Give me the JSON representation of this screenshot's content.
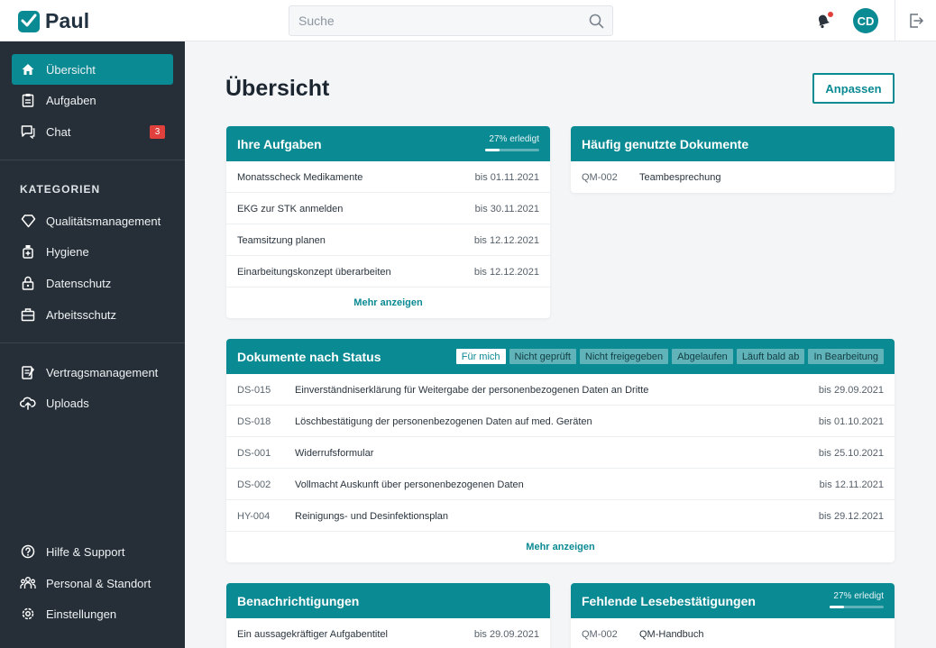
{
  "app": {
    "name": "Paul"
  },
  "header": {
    "search_placeholder": "Suche",
    "avatar_initials": "CD"
  },
  "sidebar": {
    "main": [
      {
        "label": "Übersicht",
        "icon": "home-icon",
        "active": true
      },
      {
        "label": "Aufgaben",
        "icon": "clipboard-icon"
      },
      {
        "label": "Chat",
        "icon": "chat-icon",
        "badge": "3"
      }
    ],
    "categories_heading": "KATEGORIEN",
    "categories": [
      {
        "label": "Qualitätsmanagement",
        "icon": "diamond-icon"
      },
      {
        "label": "Hygiene",
        "icon": "hygiene-bottle-icon"
      },
      {
        "label": "Datenschutz",
        "icon": "lock-icon"
      },
      {
        "label": "Arbeitsschutz",
        "icon": "briefcase-icon"
      }
    ],
    "other": [
      {
        "label": "Vertragsmanagement",
        "icon": "contract-icon"
      },
      {
        "label": "Uploads",
        "icon": "cloud-upload-icon"
      }
    ],
    "footer": [
      {
        "label": "Hilfe & Support",
        "icon": "help-icon"
      },
      {
        "label": "Personal & Standort",
        "icon": "people-icon"
      },
      {
        "label": "Einstellungen",
        "icon": "gear-icon"
      }
    ]
  },
  "main": {
    "title": "Übersicht",
    "customize_label": "Anpassen",
    "tasks": {
      "title": "Ihre Aufgaben",
      "progress_label": "27% erledigt",
      "progress": 0.27,
      "rows": [
        {
          "title": "Monatsscheck Medikamente",
          "due": "bis 01.11.2021"
        },
        {
          "title": "EKG zur STK anmelden",
          "due": "bis 30.11.2021"
        },
        {
          "title": "Teamsitzung planen",
          "due": "bis 12.12.2021"
        },
        {
          "title": "Einarbeitungskonzept überarbeiten",
          "due": "bis 12.12.2021"
        }
      ],
      "more_label": "Mehr anzeigen"
    },
    "frequent_docs": {
      "title": "Häufig genutzte Dokumente",
      "rows": [
        {
          "code": "QM-002",
          "title": "Teambesprechung"
        }
      ]
    },
    "status_docs": {
      "title": "Dokumente nach Status",
      "filters": [
        {
          "label": "Für mich",
          "active": true
        },
        {
          "label": "Nicht geprüft"
        },
        {
          "label": "Nicht freigegeben"
        },
        {
          "label": "Abgelaufen"
        },
        {
          "label": "Läuft bald ab"
        },
        {
          "label": "In Bearbeitung"
        }
      ],
      "rows": [
        {
          "code": "DS-015",
          "title": "Einverständniserklärung für Weitergabe der personenbezogenen Daten an Dritte",
          "due": "bis 29.09.2021"
        },
        {
          "code": "DS-018",
          "title": "Löschbestätigung der personenbezogenen Daten auf med. Geräten",
          "due": "bis 01.10.2021"
        },
        {
          "code": "DS-001",
          "title": "Widerrufsformular",
          "due": "bis 25.10.2021"
        },
        {
          "code": "DS-002",
          "title": "Vollmacht Auskunft über personenbezogenen Daten",
          "due": "bis 12.11.2021"
        },
        {
          "code": "HY-004",
          "title": "Reinigungs- und Desinfektionsplan",
          "due": "bis 29.12.2021"
        }
      ],
      "more_label": "Mehr anzeigen"
    },
    "notifications": {
      "title": "Benachrichtigungen",
      "rows": [
        {
          "title": "Ein aussagekräftiger Aufgabentitel",
          "due": "bis 29.09.2021"
        }
      ]
    },
    "missing_reads": {
      "title": "Fehlende Lesebestätigungen",
      "progress_label": "27% erledigt",
      "progress": 0.27,
      "rows": [
        {
          "code": "QM-002",
          "title": "QM-Handbuch"
        }
      ]
    }
  },
  "colors": {
    "accent": "#0a8a93",
    "sidebar": "#262f37",
    "badge": "#e0413d"
  }
}
